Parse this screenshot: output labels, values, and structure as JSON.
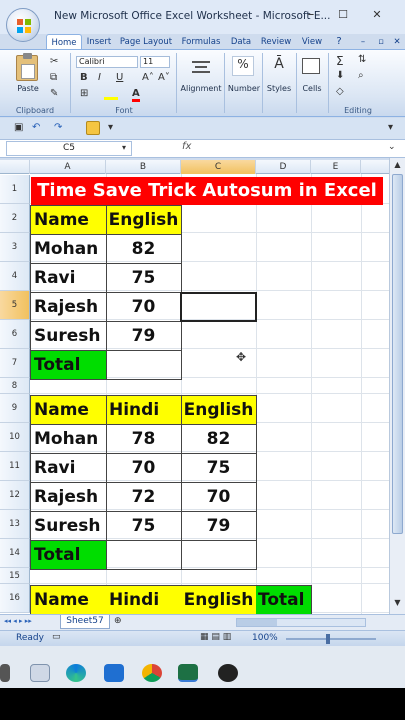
{
  "window": {
    "title": "New Microsoft Office Excel Worksheet - Microsoft E...",
    "minimize": "–",
    "maximize": "☐",
    "close": "✕"
  },
  "ribbon_tabs": [
    "Home",
    "Insert",
    "Page Layout",
    "Formulas",
    "Data",
    "Review",
    "View"
  ],
  "ribbon": {
    "paste_label": "Paste",
    "font_name": "Calibri",
    "font_size": "11",
    "bold": "B",
    "italic": "I",
    "underline": "U",
    "grow_font": "A˄",
    "shrink_font": "A˅",
    "font_color": "A",
    "alignment_label": "Alignment",
    "number_label": "Number",
    "styles_label": "Styles",
    "cells_label": "Cells",
    "clipboard_label": "Clipboard",
    "font_label": "Font",
    "editing_label": "Editing",
    "sigma": "Σ",
    "percent": "%"
  },
  "formula_bar": {
    "name_box": "C5",
    "fx": "fx",
    "value": ""
  },
  "columns": [
    "A",
    "B",
    "C",
    "D",
    "E"
  ],
  "selected_cell": "C5",
  "rows": [
    "1",
    "2",
    "3",
    "4",
    "5",
    "6",
    "7",
    "8",
    "9",
    "10",
    "11",
    "12",
    "13",
    "14",
    "15",
    "16"
  ],
  "sheet": {
    "title": "Time Save Trick Autosum in Excel",
    "table1": {
      "header": [
        "Name",
        "English"
      ],
      "rows": [
        [
          "Mohan",
          "82"
        ],
        [
          "Ravi",
          "75"
        ],
        [
          "Rajesh",
          "70"
        ],
        [
          "Suresh",
          "79"
        ]
      ],
      "total_label": "Total"
    },
    "table2": {
      "header": [
        "Name",
        "Hindi",
        "English"
      ],
      "rows": [
        [
          "Mohan",
          "78",
          "82"
        ],
        [
          "Ravi",
          "70",
          "75"
        ],
        [
          "Rajesh",
          "72",
          "70"
        ],
        [
          "Suresh",
          "75",
          "79"
        ]
      ],
      "total_label": "Total"
    },
    "table3": {
      "header": [
        "Name",
        "Hindi",
        "English",
        "Total"
      ]
    }
  },
  "sheet_tab": "Sheet57",
  "status": {
    "ready": "Ready",
    "zoom": "100%"
  },
  "colors": {
    "title_bg": "#ff0000",
    "title_text": "#ffffff",
    "header_bg": "#ffff00",
    "total_bg": "#00dd00"
  }
}
